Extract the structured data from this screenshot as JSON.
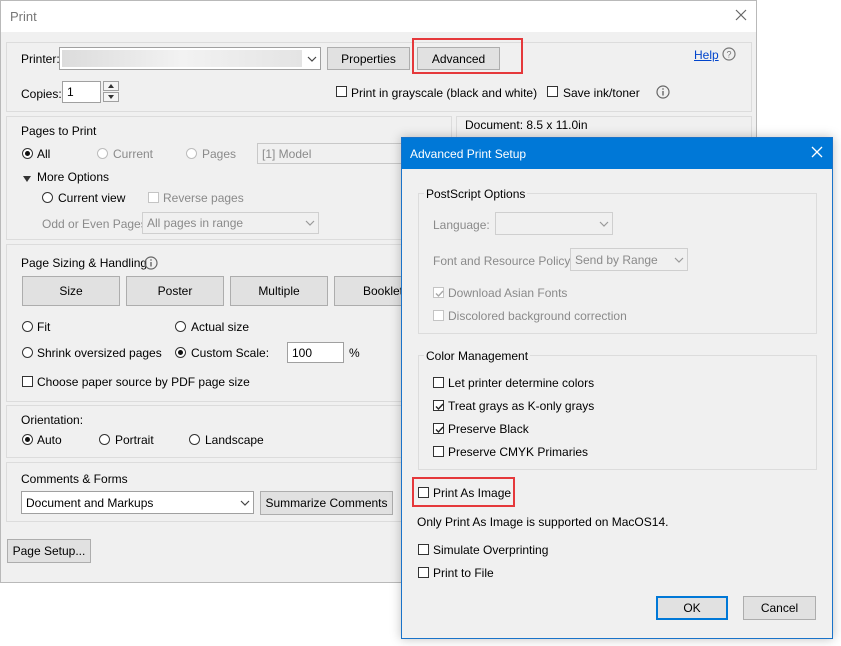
{
  "print_dialog": {
    "title": "Print",
    "printer_label": "Printer:",
    "properties_button": "Properties",
    "advanced_button": "Advanced",
    "help_link": "Help",
    "copies_label": "Copies:",
    "copies_value": "1",
    "grayscale_label": "Print in grayscale (black and white)",
    "save_ink_label": "Save ink/toner",
    "document_info": "Document: 8.5 x 11.0in",
    "pages_to_print": {
      "heading": "Pages to Print",
      "all": "All",
      "current": "Current",
      "pages": "Pages",
      "pages_value": "[1] Model",
      "more_options": "More Options",
      "current_view": "Current view",
      "reverse_pages": "Reverse pages",
      "odd_even_label": "Odd or Even Pages:",
      "odd_even_value": "All pages in range"
    },
    "page_sizing": {
      "heading": "Page Sizing & Handling",
      "tabs": [
        "Size",
        "Poster",
        "Multiple",
        "Booklet"
      ],
      "fit": "Fit",
      "actual_size": "Actual size",
      "shrink": "Shrink oversized pages",
      "custom_scale": "Custom Scale:",
      "custom_scale_value": "100",
      "percent": "%",
      "paper_source": "Choose paper source by PDF page size"
    },
    "orientation": {
      "heading": "Orientation:",
      "auto": "Auto",
      "portrait": "Portrait",
      "landscape": "Landscape"
    },
    "comments_forms": {
      "heading": "Comments & Forms",
      "value": "Document and Markups",
      "summarize_button": "Summarize Comments"
    },
    "page_setup_button": "Page Setup..."
  },
  "advanced_dialog": {
    "title": "Advanced Print Setup",
    "postscript": {
      "legend": "PostScript Options",
      "language_label": "Language:",
      "font_policy_label": "Font and Resource Policy:",
      "font_policy_value": "Send by Range",
      "download_asian_fonts": "Download Asian Fonts",
      "discolored_bg": "Discolored background correction"
    },
    "color_management": {
      "legend": "Color Management",
      "let_printer": "Let printer determine colors",
      "treat_grays": "Treat grays as K-only grays",
      "preserve_black": "Preserve Black",
      "preserve_cmyk": "Preserve CMYK Primaries"
    },
    "print_as_image": "Print As Image",
    "macos_note": "Only Print As Image is supported on MacOS14.",
    "simulate_overprinting": "Simulate Overprinting",
    "print_to_file": "Print to File",
    "ok_button": "OK",
    "cancel_button": "Cancel"
  },
  "colors": {
    "accent": "#0078d7",
    "highlight": "#e5383b",
    "link": "#0044cc"
  },
  "icons": [
    "close-icon",
    "help-icon",
    "info-icon",
    "chevron-down-icon",
    "check-icon"
  ]
}
